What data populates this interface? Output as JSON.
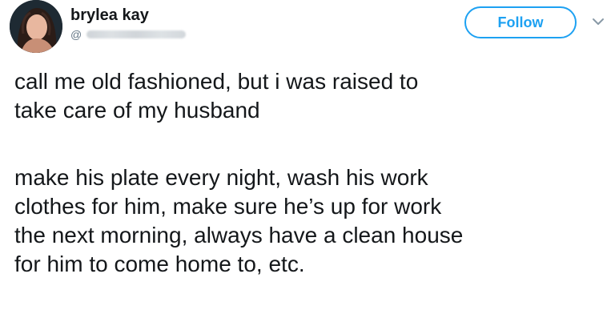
{
  "tweet": {
    "author": {
      "display_name": "brylea kay",
      "handle_prefix": "@",
      "avatar_icon": "user-avatar"
    },
    "follow_label": "Follow",
    "more_icon": "chevron-down-icon",
    "paragraphs": [
      {
        "lines": [
          "call me old fashioned, but i was raised to",
          "take care of my husband"
        ]
      },
      {
        "lines": [
          "make his plate every night, wash his work",
          "clothes for him, make sure he’s up for work",
          "the next morning, always have a clean house",
          "for him to come home to, etc."
        ]
      }
    ],
    "colors": {
      "accent": "#1da1f2",
      "text": "#14171a",
      "muted": "#657786"
    }
  }
}
